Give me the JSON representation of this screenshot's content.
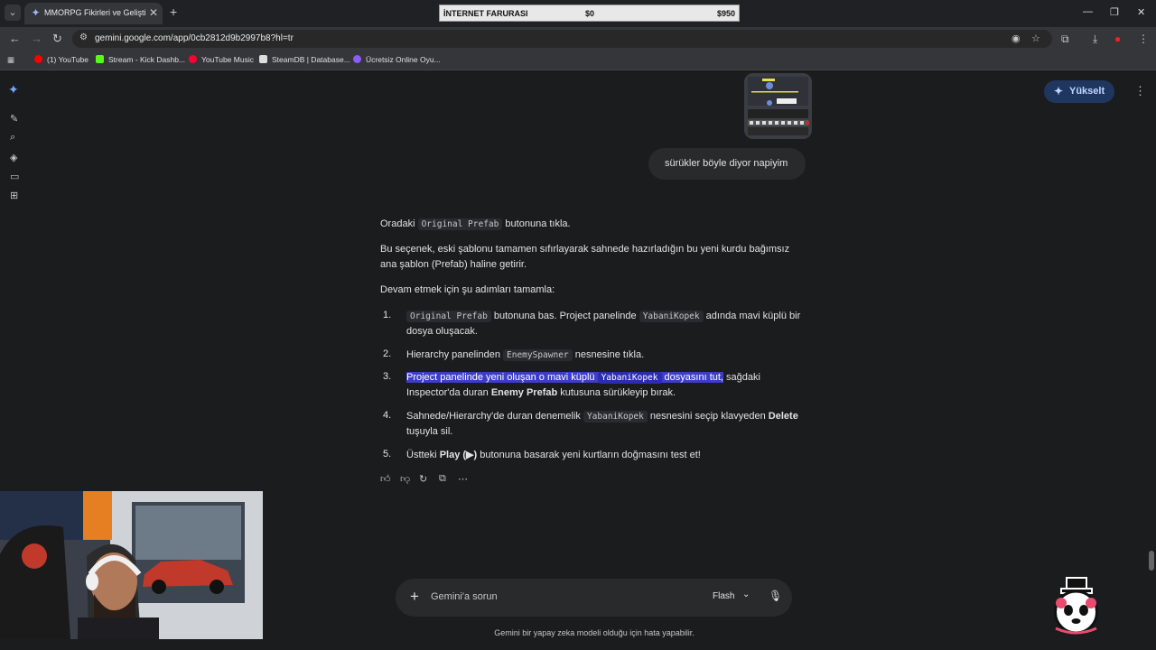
{
  "browser": {
    "tab": {
      "title": "MMORPG Fikirleri ve Geliştirme"
    },
    "ad": {
      "left": "İNTERNET FARURASI",
      "mid": "$0",
      "right": "$950"
    },
    "url": "gemini.google.com/app/0cb2812d9b2997b8?hl=tr",
    "bookmarks": [
      {
        "label": "(1) YouTube",
        "color": "#ff0000"
      },
      {
        "label": "Stream - Kick Dashb...",
        "color": "#53fc18"
      },
      {
        "label": "YouTube Music",
        "color": "#ff0033"
      },
      {
        "label": "SteamDB | Database...",
        "color": "#dddddd"
      },
      {
        "label": "Ücretsiz Online Oyu...",
        "color": "#8b5cf6"
      }
    ]
  },
  "header": {
    "upgrade_label": "Yükselt"
  },
  "user_message": "sürükler böyle diyor napiyim",
  "response": {
    "p1_a": "Oradaki ",
    "p1_code": "Original Prefab",
    "p1_b": " butonuna tıkla.",
    "p2": "Bu seçenek, eski şablonu tamamen sıfırlayarak sahnede hazırladığın bu yeni kurdu bağımsız ana şablon (Prefab) haline getirir.",
    "p3": "Devam etmek için şu adımları tamamla:",
    "steps": [
      {
        "n": "1.",
        "code1": "Original Prefab",
        "t1": " butonuna bas. Project panelinde ",
        "code2": "YabaniKopek",
        "t2": " adında mavi küplü bir dosya oluşacak."
      },
      {
        "n": "2.",
        "t1": "Hierarchy panelinden ",
        "code1": "EnemySpawner",
        "t2": " nesnesine tıkla."
      },
      {
        "n": "3.",
        "hl1": "Project panelinde yeni oluşan o mavi küplü ",
        "code1": "YabaniKopek",
        "hl2": " dosyasını tut,",
        "t1": " sağdaki Inspector'da duran ",
        "b1": "Enemy Prefab",
        "t2": " kutusuna sürükleyip bırak."
      },
      {
        "n": "4.",
        "t1": "Sahnede/Hierarchy'de duran denemelik ",
        "code1": "YabaniKopek",
        "t2": " nesnesini seçip klavyeden ",
        "b1": "Delete",
        "t3": " tuşuyla sil."
      },
      {
        "n": "5.",
        "t1": "Üstteki ",
        "b1": "Play (▶)",
        "t2": " butonuna basarak yeni kurtların doğmasını test et!"
      }
    ]
  },
  "input": {
    "placeholder": "Gemini'a sorun",
    "model": "Flash"
  },
  "disclaimer": "Gemini bir yapay zeka modeli olduğu için hata yapabilir."
}
